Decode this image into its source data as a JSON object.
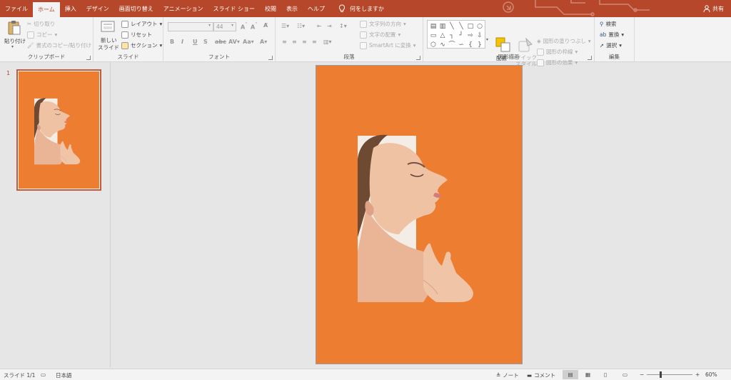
{
  "tabs": [
    "ファイル",
    "ホーム",
    "挿入",
    "デザイン",
    "画面切り替え",
    "アニメーション",
    "スライド ショー",
    "校閲",
    "表示",
    "ヘルプ"
  ],
  "active_tab": "ホーム",
  "tell_me": "何をしますか",
  "share": "共有",
  "clipboard": {
    "paste": "貼り付け",
    "cut": "切り取り",
    "copy": "コピー",
    "format_painter": "書式のコピー/貼り付け",
    "label": "クリップボード"
  },
  "slides_group": {
    "new_slide_line1": "新しい",
    "new_slide_line2": "スライド",
    "layout": "レイアウト",
    "reset": "リセット",
    "section": "セクション",
    "label": "スライド"
  },
  "font_group": {
    "font_size": "44",
    "label": "フォント"
  },
  "paragraph_group": {
    "text_direction": "文字列の方向",
    "align_text": "文字の配置",
    "smartart": "SmartArt に変換",
    "label": "段落"
  },
  "drawing_group": {
    "arrange": "配置",
    "quick_styles_line1": "クイック",
    "quick_styles_line2": "スタイル",
    "shape_fill": "図形の塗りつぶし",
    "shape_outline": "図形の枠線",
    "shape_effects": "図形の効果",
    "label": "図形描画"
  },
  "editing_group": {
    "find": "検索",
    "replace": "置換",
    "select": "選択",
    "label": "編集"
  },
  "slide_number": "1",
  "status": {
    "slide_count": "スライド 1/1",
    "language": "日本語",
    "notes": "ノート",
    "comments": "コメント",
    "zoom": "60%"
  },
  "colors": {
    "accent": "#b7472a",
    "slide_bg": "#ed7d31"
  }
}
